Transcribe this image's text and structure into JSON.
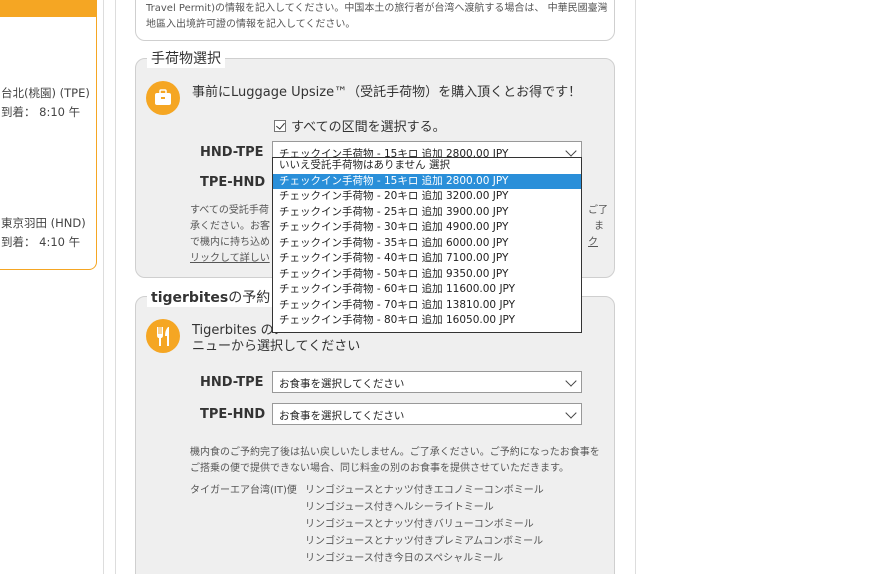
{
  "itinerary": {
    "leg1_from": "台北(桃園) (TPE)",
    "leg1_arrival": "到着：  8:10 午",
    "leg2_from": "東京羽田 (HND)",
    "leg2_arrival": "到着：  4:10 午"
  },
  "travel_permit": {
    "line1": "Travel Permit)の情報を記入してください。中国本土の旅行者が台湾へ渡航する場合は、 中華民國臺灣",
    "line2": "地區入出境許可證の情報を記入してください。"
  },
  "baggage": {
    "legend": "手荷物選択",
    "promo": "事前にLuggage Upsize™（受託手荷物）を購入頂くとお得です！",
    "select_all_label": "すべての区間を選択する。",
    "routes": [
      {
        "label": "HND-TPE",
        "value": "チェックイン手荷物 - 15キロ 追加 2800.00 JPY"
      },
      {
        "label": "TPE-HND",
        "value": ""
      }
    ],
    "note_line1": "すべての受託手荷",
    "note_line1_end": "ご了",
    "note_line2": "承ください。お客",
    "note_line2_end": "ま",
    "note_line3": "で機内に持ち込め",
    "note_line3_end": "ク",
    "note_line4": "リックして詳しい",
    "dropdown_options": [
      "いいえ受託手荷物はありません 選択",
      "チェックイン手荷物 - 15キロ 追加 2800.00 JPY",
      "チェックイン手荷物 - 20キロ 追加 3200.00 JPY",
      "チェックイン手荷物 - 25キロ 追加 3900.00 JPY",
      "チェックイン手荷物 - 30キロ 追加 4900.00 JPY",
      "チェックイン手荷物 - 35キロ 追加 6000.00 JPY",
      "チェックイン手荷物 - 40キロ 追加 7100.00 JPY",
      "チェックイン手荷物 - 50キロ 追加 9350.00 JPY",
      "チェックイン手荷物 - 60キロ 追加 11600.00 JPY",
      "チェックイン手荷物 - 70キロ 追加 13810.00 JPY",
      "チェックイン手荷物 - 80キロ 追加 16050.00 JPY"
    ],
    "selected_index": 1
  },
  "meals": {
    "legend_bold": "tigerbites",
    "legend_rest": "の予約",
    "intro_line1": "Tigerbites のメ",
    "intro_line2": "ニューから選択してください",
    "routes": [
      {
        "label": "HND-TPE",
        "value": "お食事を選択してください"
      },
      {
        "label": "TPE-HND",
        "value": "お食事を選択してください"
      }
    ],
    "note_line1": "機内食のご予約完了後は払い戻しいたしません。ご了承ください。ご予約になったお食事を",
    "note_line2": "ご搭乗の便で提供できない場合、同じ料金の別のお食事を提供させていただきます。",
    "airline_label": "タイガーエア台湾(IT)便",
    "menu_items": [
      "リンゴジュースとナッツ付きエコノミーコンボミール",
      "リンゴジュース付きヘルシーライトミール",
      "リンゴジュースとナッツ付きバリューコンボミール",
      "リンゴジュースとナッツ付きプレミアムコンボミール",
      "リンゴジュース付き今日のスペシャルミール"
    ]
  },
  "colors": {
    "accent": "#f5a623",
    "selected": "#2a8fd9"
  }
}
